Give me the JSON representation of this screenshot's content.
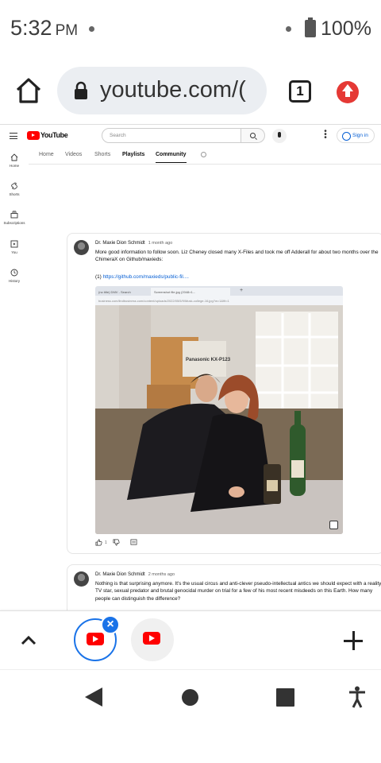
{
  "status_bar": {
    "time": "5:32",
    "ampm": "PM",
    "battery": "100%"
  },
  "browser": {
    "url": "youtube.com/(",
    "tab_count": "1"
  },
  "youtube": {
    "logo_text": "YouTube",
    "search_placeholder": "Search",
    "signin_label": "Sign in",
    "nav": [
      {
        "label": "Home",
        "icon": "home-icon"
      },
      {
        "label": "Shorts",
        "icon": "shorts-icon"
      },
      {
        "label": "Subscriptions",
        "icon": "subscriptions-icon"
      },
      {
        "label": "You",
        "icon": "you-icon"
      },
      {
        "label": "History",
        "icon": "history-icon"
      }
    ],
    "tabs": [
      "Home",
      "Videos",
      "Shorts",
      "Playlists",
      "Community"
    ],
    "active_tab": "Community"
  },
  "posts": [
    {
      "author": "Dr. Maxie Dion Schmidt",
      "time": "1 month ago",
      "text": "More good information to follow soon. Liz Cheney closed many X-Files and took me off Adderall for about two months over the ChimeraX on Github/maxieds:",
      "link_prefix": "(1) ",
      "link": "https://github.com/maxieds/public-fil....",
      "image_tab_1": "(no title) DMV - Search",
      "image_tab_2": "Screenshot file.jpg (2048×1...",
      "image_url": "business.com/lindbusiness.com/content/uploads/2022/05/5/9/Musk-college-16.jpg?w=1&fit=1",
      "like_count": "1"
    },
    {
      "author": "Dr. Maxie Dion Schmidt",
      "time": "2 months ago",
      "text": "Nothing is that surprising anymore. It's the usual circus and anti-clever pseudo-intellectual antics we should expect with a reality TV star, sexual predator and brutal genocidal murder on trial for a few of his most recent misdeeds on this Earth. How many people can distinguish the difference?"
    }
  ],
  "photo_box_label": "Panasonic KX-P123",
  "colors": {
    "youtube_red": "#ff0000",
    "link_blue": "#065fd4",
    "chrome_blue": "#1a73e8",
    "update_red": "#e53935"
  }
}
